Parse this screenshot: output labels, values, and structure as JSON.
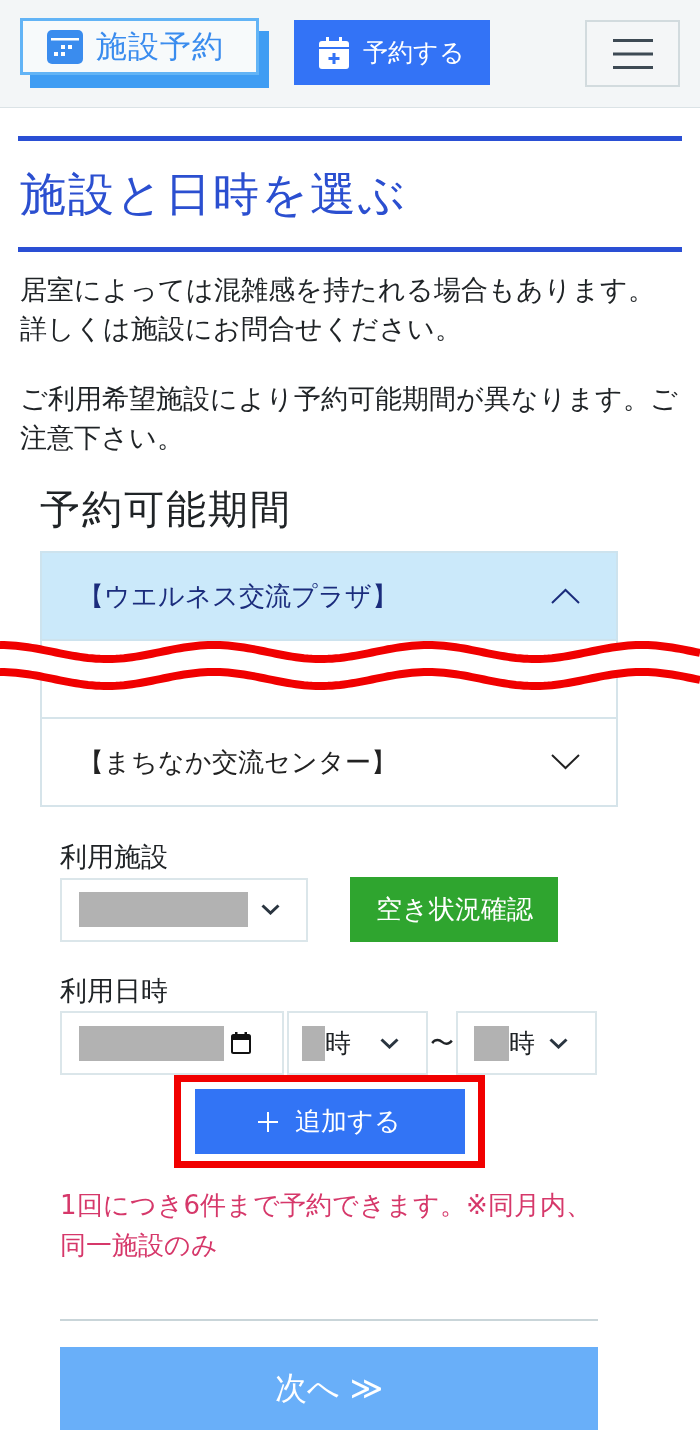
{
  "header": {
    "logo": "施設予約",
    "reserve_button": "予約する"
  },
  "section": {
    "title": "施設と日時を選ぶ",
    "notes": [
      [
        "居室によっては混雑感を持たれる場合もあります。",
        "詳しくは施設にお問合せください。"
      ],
      [
        "ご利用希望施設により予約可能期間が異なります。ご注意下さい。"
      ]
    ]
  },
  "periods": {
    "heading": "予約可能期間",
    "items": [
      {
        "label": "【ウエルネス交流プラザ】",
        "expanded": true
      },
      {
        "label": "【まちなか交流センター】",
        "expanded": false
      }
    ]
  },
  "form": {
    "facility_label": "利用施設",
    "availability_button": "空き状況確認",
    "datetime_label": "利用日時",
    "start_hour_unit": "時",
    "range_separator": "〜",
    "end_hour_unit": "時",
    "add_button": "追加する",
    "notice": "1回につき6件まで予約できます。※同月内、同一施設のみ"
  },
  "next_button": "次へ ≫"
}
